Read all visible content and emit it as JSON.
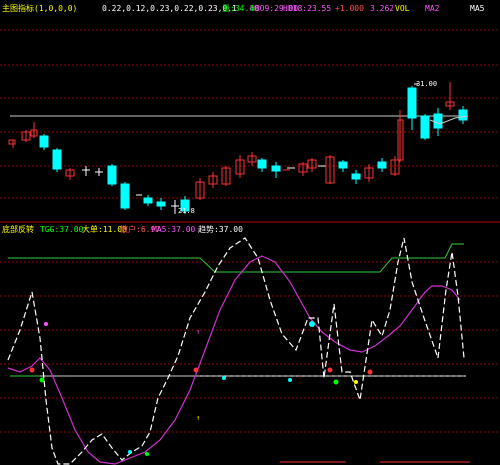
{
  "main_header": {
    "title": "主图指标(1,0,0,0)",
    "items": [
      {
        "text": "主力线",
        "color": "#ffff00"
      },
      {
        "text": "0.22,0.12,0.23,0.22,0.23,0.1",
        "color": "#ffffff"
      },
      {
        "text": "量:34.40",
        "color": "#00ff00"
      },
      {
        "text": "HBO9:29.00",
        "color": "#ff55ff"
      },
      {
        "text": "HB18:23.55",
        "color": "#ff55ff"
      },
      {
        "text": "+1.000",
        "color": "#ff5555"
      },
      {
        "text": "3.262",
        "color": "#ff55ff"
      }
    ],
    "right_labels": [
      {
        "text": "VOL",
        "color": "#ffff00"
      },
      {
        "text": "MA2",
        "color": "#ff55ff"
      },
      {
        "text": "MA5",
        "color": "#ffffff"
      }
    ]
  },
  "price_annotations": {
    "high": "31.00",
    "low": "21.8"
  },
  "indicator_header": {
    "title": "底部反转",
    "items": [
      {
        "text": "TGG:37.00",
        "color": "#00ff00"
      },
      {
        "text": "大单:11.00",
        "color": "#ffff00"
      },
      {
        "text": "散户:6.97",
        "color": "#ff5555"
      },
      {
        "text": "MA5:37.00",
        "color": "#ff55ff"
      },
      {
        "text": "趋势:37.00",
        "color": "#ffffff"
      }
    ]
  },
  "indicator_marks": {
    "m1": "↑",
    "m2": "↑"
  },
  "colors": {
    "background": "#000000",
    "grid": "#9a0000",
    "up_candle": "#ff3333",
    "down_candle": "#00ffff",
    "ma_line": "#ffffff",
    "trend_line": "#ffffff",
    "ma5_line": "#cc33cc",
    "upper_line": "#33cc33"
  }
}
